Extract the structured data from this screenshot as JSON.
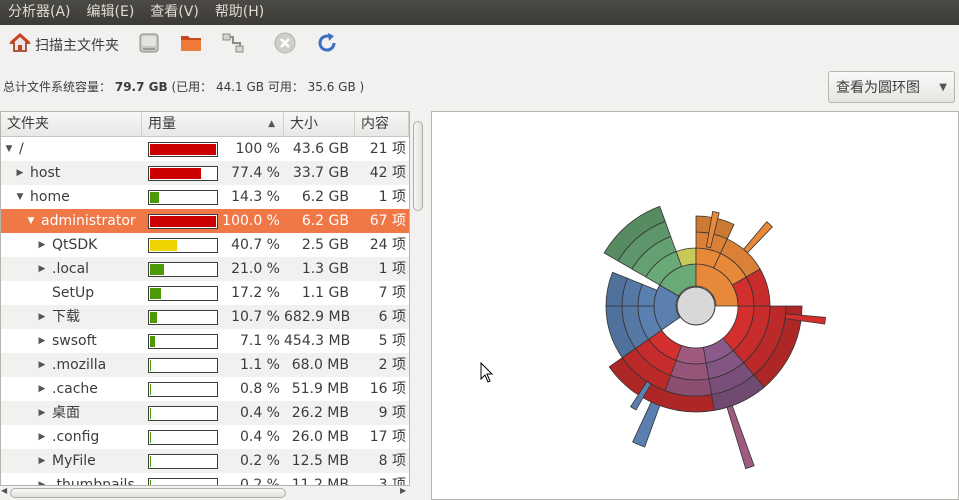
{
  "menubar": {
    "items": [
      "分析器(A)",
      "编辑(E)",
      "查看(V)",
      "帮助(H)"
    ]
  },
  "toolbar": {
    "scan_home_label": "扫描主文件夹",
    "icons": [
      "home-icon",
      "drive-icon",
      "folder-icon",
      "remote-icon",
      "stop-icon",
      "refresh-icon"
    ]
  },
  "capacity": {
    "label": "总计文件系统容量：",
    "total": "79.7 GB",
    "detail": "(已用：  44.1 GB 可用：  35.6 GB )"
  },
  "view_combo": {
    "value": "查看为圆环图"
  },
  "tree": {
    "columns": [
      "文件夹",
      "用量",
      "大小",
      "内容"
    ],
    "rows": [
      {
        "name": "/",
        "expander": "open",
        "indent": 0,
        "fraction": 1.0,
        "color": "#cc0000",
        "pct": "100 %",
        "size": "43.6 GB",
        "items": "21 项"
      },
      {
        "name": "host",
        "expander": "closed",
        "indent": 1,
        "fraction": 0.774,
        "color": "#cc0000",
        "pct": "77.4 %",
        "size": "33.7 GB",
        "items": "42 项"
      },
      {
        "name": "home",
        "expander": "open",
        "indent": 1,
        "fraction": 0.143,
        "color": "#4e9a06",
        "pct": "14.3 %",
        "size": "6.2 GB",
        "items": "1 项"
      },
      {
        "name": "administrator",
        "expander": "open",
        "indent": 2,
        "fraction": 1.0,
        "color": "#cc0000",
        "pct": "100.0 %",
        "size": "6.2 GB",
        "items": "67 项",
        "selected": true
      },
      {
        "name": "QtSDK",
        "expander": "closed",
        "indent": 3,
        "fraction": 0.407,
        "color": "#edd400",
        "pct": "40.7 %",
        "size": "2.5 GB",
        "items": "24 项"
      },
      {
        "name": ".local",
        "expander": "closed",
        "indent": 3,
        "fraction": 0.21,
        "color": "#4e9a06",
        "pct": "21.0 %",
        "size": "1.3 GB",
        "items": "1 项"
      },
      {
        "name": "SetUp",
        "expander": "none",
        "indent": 3,
        "fraction": 0.172,
        "color": "#4e9a06",
        "pct": "17.2 %",
        "size": "1.1 GB",
        "items": "7 项"
      },
      {
        "name": "下载",
        "expander": "closed",
        "indent": 3,
        "fraction": 0.107,
        "color": "#4e9a06",
        "pct": "10.7 %",
        "size": "682.9 MB",
        "items": "6 项"
      },
      {
        "name": "swsoft",
        "expander": "closed",
        "indent": 3,
        "fraction": 0.071,
        "color": "#4e9a06",
        "pct": "7.1 %",
        "size": "454.3 MB",
        "items": "5 项"
      },
      {
        "name": ".mozilla",
        "expander": "closed",
        "indent": 3,
        "fraction": 0.011,
        "color": "#4e9a06",
        "pct": "1.1 %",
        "size": "68.0 MB",
        "items": "2 项"
      },
      {
        "name": ".cache",
        "expander": "closed",
        "indent": 3,
        "fraction": 0.008,
        "color": "#4e9a06",
        "pct": "0.8 %",
        "size": "51.9 MB",
        "items": "16 项"
      },
      {
        "name": "桌面",
        "expander": "closed",
        "indent": 3,
        "fraction": 0.004,
        "color": "#4e9a06",
        "pct": "0.4 %",
        "size": "26.2 MB",
        "items": "9 项"
      },
      {
        "name": ".config",
        "expander": "closed",
        "indent": 3,
        "fraction": 0.004,
        "color": "#4e9a06",
        "pct": "0.4 %",
        "size": "26.0 MB",
        "items": "17 项"
      },
      {
        "name": "MyFile",
        "expander": "closed",
        "indent": 3,
        "fraction": 0.002,
        "color": "#4e9a06",
        "pct": "0.2 %",
        "size": "12.5 MB",
        "items": "8 项"
      },
      {
        "name": ".thumbnails",
        "expander": "closed",
        "indent": 3,
        "fraction": 0.002,
        "color": "#4e9a06",
        "pct": "0.2 %",
        "size": "11.2 MB",
        "items": "3 项"
      }
    ]
  },
  "ring_chart": {
    "colors": {
      "red": "#d42f2f",
      "green": "#6aaa78",
      "yellow": "#c9c95a",
      "orange": "#e8893a",
      "blue": "#5b80b0",
      "purple": "#8a5a8a",
      "mauve": "#a05a80",
      "center": "#d8d8d8"
    }
  }
}
